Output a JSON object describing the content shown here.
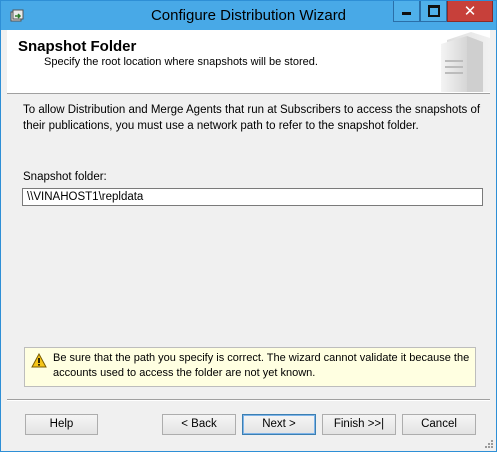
{
  "window": {
    "title": "Configure Distribution Wizard",
    "controls": {
      "minimize": "minimize",
      "maximize": "maximize",
      "close": "✕"
    }
  },
  "header": {
    "title": "Snapshot Folder",
    "subtitle": "Specify the root location where snapshots will be stored."
  },
  "content": {
    "intro": "To allow Distribution and Merge Agents that run at Subscribers to access the snapshots of their publications, you must use a network path to refer to the snapshot folder.",
    "folder_label": "Snapshot folder:",
    "folder_value": "\\\\VINAHOST1\\repldata"
  },
  "warning": {
    "icon": "warning-icon",
    "text": "Be sure that the path you specify is correct. The wizard cannot validate it because the accounts used to access the folder are not yet known."
  },
  "buttons": {
    "help": "Help",
    "back": "< Back",
    "next": "Next >",
    "finish": "Finish >>|",
    "cancel": "Cancel"
  },
  "colors": {
    "titlebar": "#48a9e7",
    "close": "#c7403a",
    "warning_bg": "#ffffe1",
    "window_bg": "#f0f0f0"
  }
}
